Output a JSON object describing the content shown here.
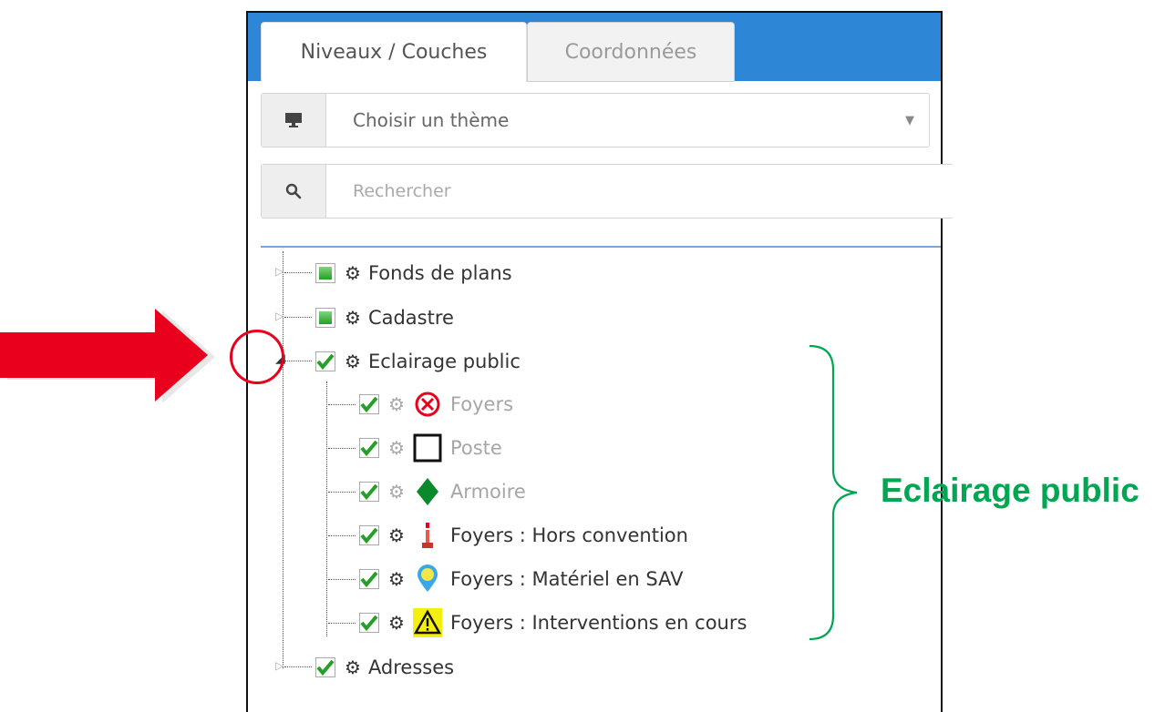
{
  "tabs": [
    {
      "label": "Niveaux / Couches",
      "active": true
    },
    {
      "label": "Coordonnées",
      "active": false
    }
  ],
  "theme_select": {
    "icon": "monitor-icon",
    "value": "Choisir un thème"
  },
  "search": {
    "icon": "search-icon",
    "placeholder": "Rechercher"
  },
  "tree": {
    "fonds": {
      "label": "Fonds de plans",
      "checked": "partial"
    },
    "cadastre": {
      "label": "Cadastre",
      "checked": "partial"
    },
    "eclairage": {
      "label": "Eclairage public",
      "checked": true,
      "expanded": true,
      "children": [
        {
          "label": "Foyers",
          "icon": "red-cross-circle-icon",
          "dimmed": true
        },
        {
          "label": "Poste",
          "icon": "black-square-icon",
          "dimmed": true
        },
        {
          "label": "Armoire",
          "icon": "green-diamond-icon",
          "dimmed": true
        },
        {
          "label": "Foyers : Hors convention",
          "icon": "red-street-light-icon",
          "dimmed": false
        },
        {
          "label": "Foyers : Matériel en SAV",
          "icon": "blue-map-pin-icon",
          "dimmed": false
        },
        {
          "label": "Foyers : Interventions en cours",
          "icon": "warning-triangle-icon",
          "dimmed": false
        }
      ]
    },
    "adresses": {
      "label": "Adresses",
      "checked": true
    }
  },
  "annotation": {
    "text": "Eclairage public",
    "color": "#00a651"
  },
  "colors": {
    "tabbar": "#2e86d6",
    "arrow": "#e8001c",
    "check": "#25a025"
  }
}
